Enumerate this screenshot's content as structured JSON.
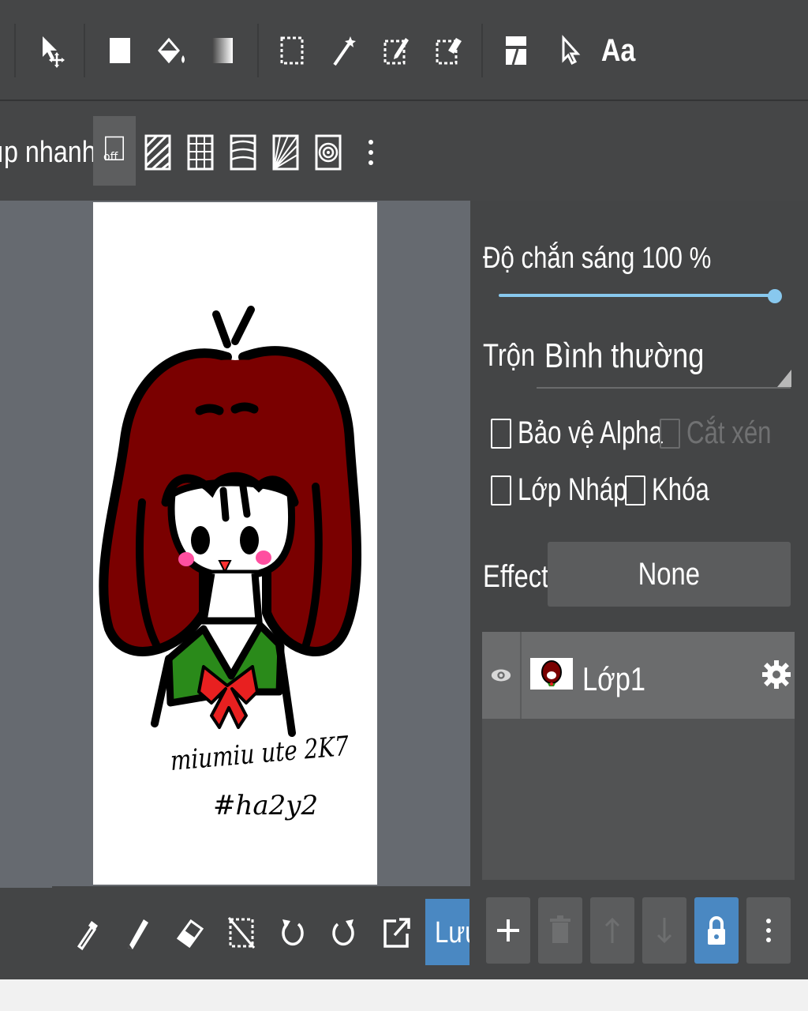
{
  "quick_snap": {
    "label": "ıp nhanh",
    "off_label": "off"
  },
  "top_toolbar": {
    "text_tool_label": "Aa"
  },
  "layer_panel": {
    "opacity_label": "Độ chắn sáng",
    "opacity_value": "100",
    "opacity_unit": "%",
    "opacity_level": 1.0,
    "blend_label": "Trộn",
    "blend_value": "Bình thường",
    "protect_alpha_label": "Bảo vệ Alpha",
    "clipping_label": "Cắt xén",
    "draft_layer_label": "Lớp Nháp",
    "lock_label": "Khóa",
    "effect_label": "Effect",
    "effect_value": "None",
    "layers": [
      {
        "name": "Lớp1",
        "visible": true
      }
    ]
  },
  "canvas": {
    "signature_line1": "miumiu ute 2K7",
    "signature_line2": "#ha2y2"
  },
  "bottom_bar": {
    "save_label": "Lưu"
  },
  "colors": {
    "toolbar_bg": "#454647",
    "canvas_bg": "#666a70",
    "accent_blue": "#4a88c2",
    "slider": "#88c8ee",
    "hair": "#7a0000",
    "collar": "#2a8a1a",
    "bow": "#e82020"
  }
}
